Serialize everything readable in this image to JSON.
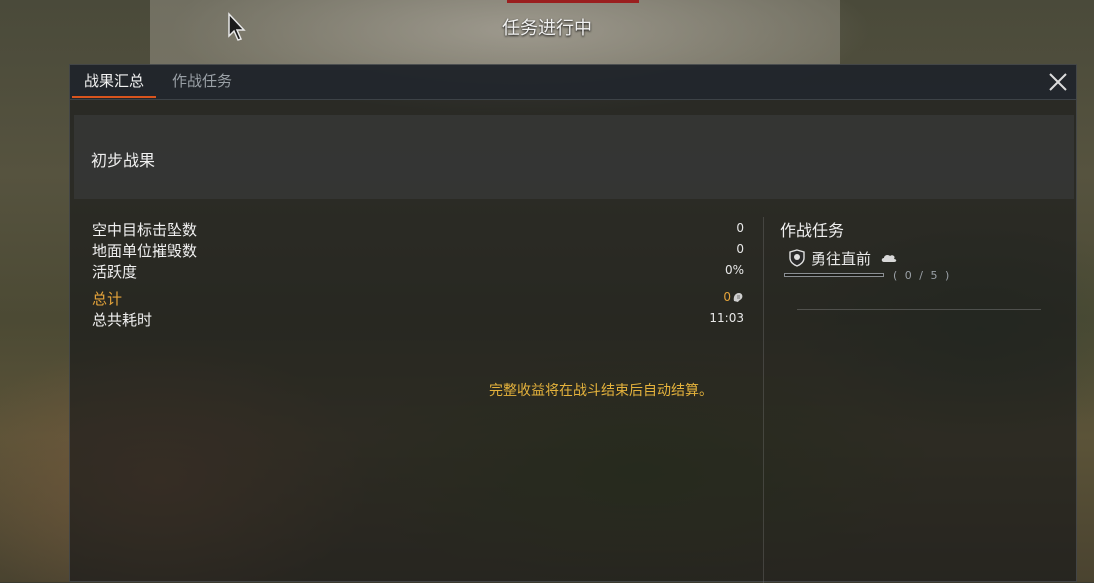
{
  "mission": {
    "title": "任务进行中"
  },
  "tabs": [
    {
      "label": "战果汇总",
      "active": true
    },
    {
      "label": "作战任务",
      "active": false
    }
  ],
  "header": {
    "title": "初步战果"
  },
  "stats": [
    {
      "label": "空中目标击坠数",
      "value": "0"
    },
    {
      "label": "地面单位摧毁数",
      "value": "0"
    },
    {
      "label": "活跃度",
      "value": "0%"
    }
  ],
  "total": {
    "label": "总计",
    "value": "0"
  },
  "time": {
    "label": "总共耗时",
    "value": "11:03"
  },
  "notice": "完整收益将在战斗结束后自动结算。",
  "tasks": {
    "title": "作战任务",
    "items": [
      {
        "name": "勇往直前",
        "progress": 0,
        "count": "( 0 / 5 )"
      }
    ]
  },
  "colors": {
    "accent": "#d9541e",
    "gold": "#e4a33a",
    "mission_bar": "#9a1f1f"
  },
  "icons": [
    "cursor-icon",
    "close-icon",
    "research-points-icon",
    "shield-icon",
    "cloud-icon"
  ]
}
